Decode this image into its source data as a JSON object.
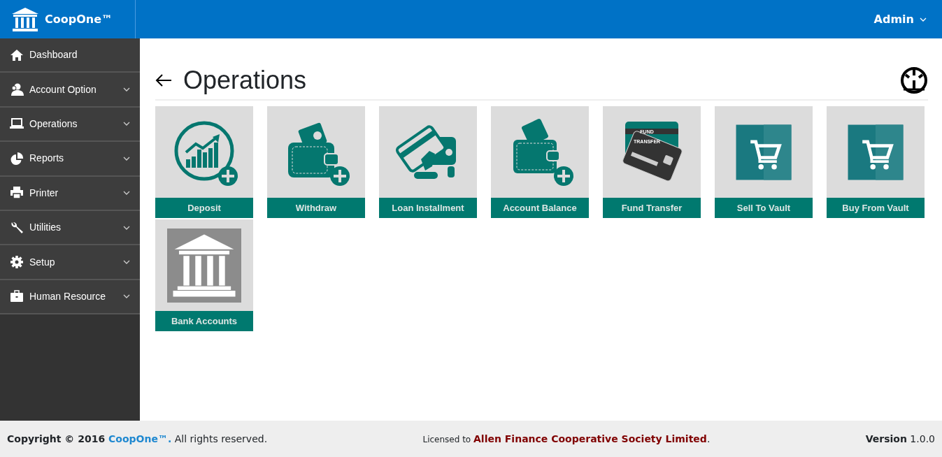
{
  "header": {
    "brand": "CoopOne™",
    "user": "Admin"
  },
  "sidebar": {
    "items": [
      {
        "label": "Dashboard",
        "expandable": false
      },
      {
        "label": "Account Option",
        "expandable": true
      },
      {
        "label": "Operations",
        "expandable": true
      },
      {
        "label": "Reports",
        "expandable": true
      },
      {
        "label": "Printer",
        "expandable": true
      },
      {
        "label": "Utilities",
        "expandable": true
      },
      {
        "label": "Setup",
        "expandable": true
      },
      {
        "label": "Human Resource",
        "expandable": true
      }
    ]
  },
  "page": {
    "title": "Operations"
  },
  "tiles": [
    {
      "label": "Deposit",
      "kind": "chart"
    },
    {
      "label": "Withdraw",
      "kind": "wallet"
    },
    {
      "label": "Loan Installment",
      "kind": "loan"
    },
    {
      "label": "Account Balance",
      "kind": "money"
    },
    {
      "label": "Fund Transfer",
      "kind": "card",
      "image_text": [
        "FUND",
        "TRANSFER"
      ]
    },
    {
      "label": "Sell To Vault",
      "kind": "cart"
    },
    {
      "label": "Buy From Vault",
      "kind": "cart"
    },
    {
      "label": "Bank Accounts",
      "kind": "bank"
    }
  ],
  "footer": {
    "copyright": "Copyright © 2016",
    "brand": "CoopOne™.",
    "rights": "All rights reserved.",
    "license_prefix": "Licensed to",
    "licensee": "Allen Finance Cooperative Society Limited",
    "license_suffix": ".",
    "version": "**Version** 1.0.0"
  }
}
